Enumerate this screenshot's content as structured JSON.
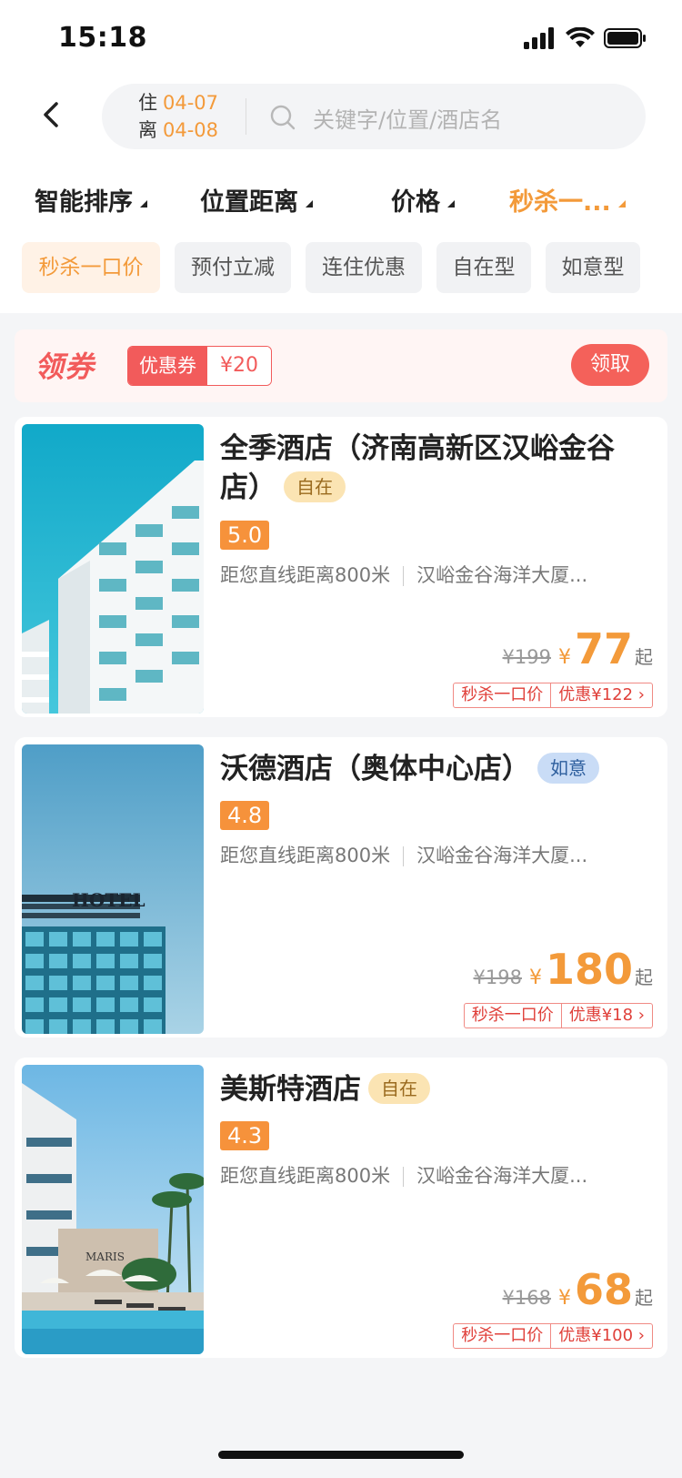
{
  "status": {
    "time": "15:18"
  },
  "search": {
    "checkin_label": "住",
    "checkin_date": "04-07",
    "checkout_label": "离",
    "checkout_date": "04-08",
    "placeholder": "关键字/位置/酒店名"
  },
  "sort": [
    {
      "label": "智能排序",
      "active": false
    },
    {
      "label": "位置距离",
      "active": false
    },
    {
      "label": "价格",
      "active": false
    },
    {
      "label": "秒杀一...",
      "active": true
    }
  ],
  "filters": [
    {
      "label": "秒杀一口价",
      "active": true
    },
    {
      "label": "预付立减",
      "active": false
    },
    {
      "label": "连住优惠",
      "active": false
    },
    {
      "label": "自在型",
      "active": false
    },
    {
      "label": "如意型",
      "active": false
    }
  ],
  "coupon": {
    "title": "领券",
    "tag_label": "优惠券",
    "tag_value": "¥20",
    "button": "领取"
  },
  "hotels": [
    {
      "name": "全季酒店（济南高新区汉峪金谷店）",
      "type": "自在",
      "score": "5.0",
      "distance": "距您直线距离800米",
      "landmark": "汉峪金谷海洋大厦...",
      "old_price": "¥199",
      "yen": "¥",
      "price": "77",
      "suffix": "起",
      "deal_label": "秒杀一口价",
      "deal_discount": "优惠¥122",
      "deal_arrow": "›"
    },
    {
      "name": "沃德酒店（奥体中心店）",
      "type": "如意",
      "score": "4.8",
      "distance": "距您直线距离800米",
      "landmark": "汉峪金谷海洋大厦...",
      "old_price": "¥198",
      "yen": "¥",
      "price": "180",
      "suffix": "起",
      "deal_label": "秒杀一口价",
      "deal_discount": "优惠¥18",
      "deal_arrow": "›"
    },
    {
      "name": "美斯特酒店",
      "type": "自在",
      "score": "4.3",
      "distance": "距您直线距离800米",
      "landmark": "汉峪金谷海洋大厦...",
      "old_price": "¥168",
      "yen": "¥",
      "price": "68",
      "suffix": "起",
      "deal_label": "秒杀一口价",
      "deal_discount": "优惠¥100",
      "deal_arrow": "›"
    }
  ],
  "colors": {
    "accent": "#f39a3a",
    "coupon_red": "#f25b5b"
  }
}
